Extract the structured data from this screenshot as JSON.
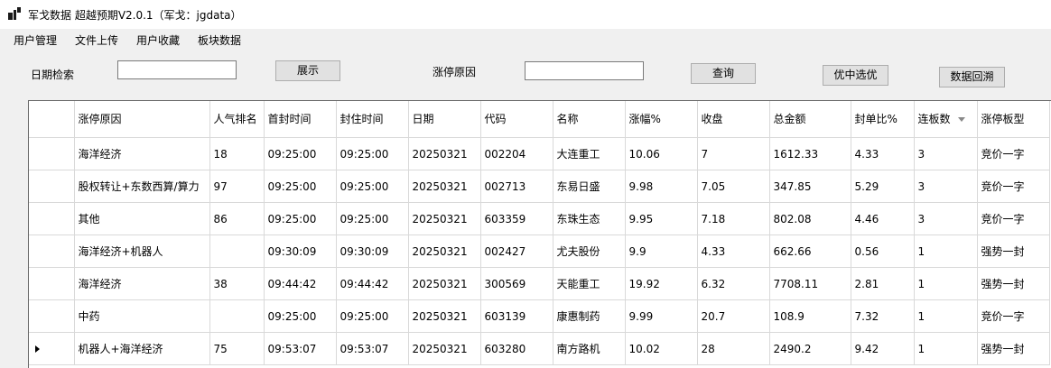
{
  "window": {
    "title": "军戈数据 超越预期V2.0.1（军戈：jgdata）"
  },
  "menu": [
    "用户管理",
    "文件上传",
    "用户收藏",
    "板块数据"
  ],
  "search": {
    "date_label": "日期检索",
    "date_value": "",
    "show_button": "展示",
    "reason_label": "涨停原因",
    "reason_value": "",
    "query_button": "查询",
    "select_button": "优中选优",
    "backtrack_button": "数据回溯"
  },
  "grid": {
    "columns": [
      "涨停原因",
      "人气排名",
      "首封时间",
      "封住时间",
      "日期",
      "代码",
      "名称",
      "涨幅%",
      "收盘",
      "总金额",
      "封单比%",
      "连板数",
      "涨停板型"
    ],
    "current_row": 6,
    "rows": [
      [
        "海洋经济",
        "18",
        "09:25:00",
        "09:25:00",
        "20250321",
        "002204",
        "大连重工",
        "10.06",
        "7",
        "1612.33",
        "4.33",
        "3",
        "竞价一字"
      ],
      [
        "股权转让+东数西算/算力",
        "97",
        "09:25:00",
        "09:25:00",
        "20250321",
        "002713",
        "东易日盛",
        "9.98",
        "7.05",
        "347.85",
        "5.29",
        "3",
        "竞价一字"
      ],
      [
        "其他",
        "86",
        "09:25:00",
        "09:25:00",
        "20250321",
        "603359",
        "东珠生态",
        "9.95",
        "7.18",
        "802.08",
        "4.46",
        "3",
        "竞价一字"
      ],
      [
        "海洋经济+机器人",
        "",
        "09:30:09",
        "09:30:09",
        "20250321",
        "002427",
        "尤夫股份",
        "9.9",
        "4.33",
        "662.66",
        "0.56",
        "1",
        "强势一封"
      ],
      [
        "海洋经济",
        "38",
        "09:44:42",
        "09:44:42",
        "20250321",
        "300569",
        "天能重工",
        "19.92",
        "6.32",
        "7708.11",
        "2.81",
        "1",
        "强势一封"
      ],
      [
        "中药",
        "",
        "09:25:00",
        "09:25:00",
        "20250321",
        "603139",
        "康惠制药",
        "9.99",
        "20.7",
        "108.9",
        "7.32",
        "1",
        "竞价一字"
      ],
      [
        "机器人+海洋经济",
        "75",
        "09:53:07",
        "09:53:07",
        "20250321",
        "603280",
        "南方路机",
        "10.02",
        "28",
        "2490.2",
        "9.42",
        "1",
        "强势一封"
      ]
    ]
  }
}
